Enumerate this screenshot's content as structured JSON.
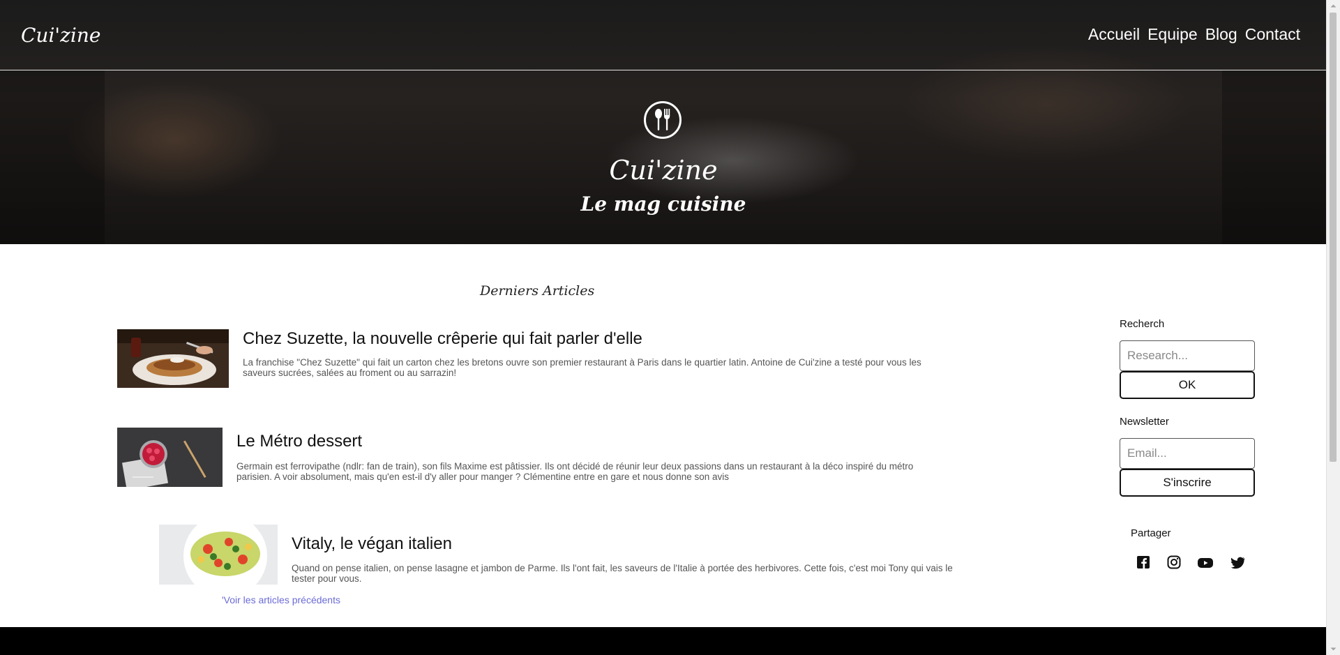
{
  "header": {
    "brand": "Cui'zine",
    "nav": [
      "Accueil",
      "Equipe",
      "Blog",
      "Contact"
    ]
  },
  "hero": {
    "logo_icon": "utensils-icon",
    "title": "Cui'zine",
    "subtitle": "Le mag cuisine"
  },
  "main": {
    "section_title": "Derniers Articles",
    "articles": [
      {
        "title": "Chez Suzette, la nouvelle crêperie qui fait parler d'elle",
        "excerpt": "La franchise \"Chez Suzette\" qui fait un carton chez les bretons ouvre son premier restaurant à Paris dans le quartier latin. Antoine de Cui'zine a testé pour vous les saveurs sucrées, salées au froment ou au sarrazin!"
      },
      {
        "title": "Le Métro dessert",
        "excerpt": "Germain est ferrovipathe (ndlr: fan de train), son fils Maxime est pâtissier. Ils ont décidé de réunir leur deux passions dans un restaurant à la déco inspiré du métro parisien. A voir absolument, mais qu'en est-il d'y aller pour manger ? Clémentine entre en gare et nous donne son avis"
      },
      {
        "title": "Vitaly, le végan italien",
        "excerpt": "Quand on pense italien, on pense lasagne et jambon de Parme. Ils l'ont fait, les saveurs de l'Italie à portée des herbivores. Cette fois, c'est moi Tony qui vais le tester pour vous."
      }
    ],
    "more_link": "'Voir les articles précédents"
  },
  "sidebar": {
    "search_label": "Recherch",
    "search_placeholder": "Research...",
    "search_button": "OK",
    "newsletter_label": "Newsletter",
    "email_placeholder": "Email...",
    "subscribe_button": "S'inscrire",
    "share_label": "Partager",
    "social_icons": [
      "facebook-icon",
      "instagram-icon",
      "youtube-icon",
      "twitter-icon"
    ]
  },
  "colors": {
    "link": "#6b6bd6",
    "footer": "#000000"
  }
}
